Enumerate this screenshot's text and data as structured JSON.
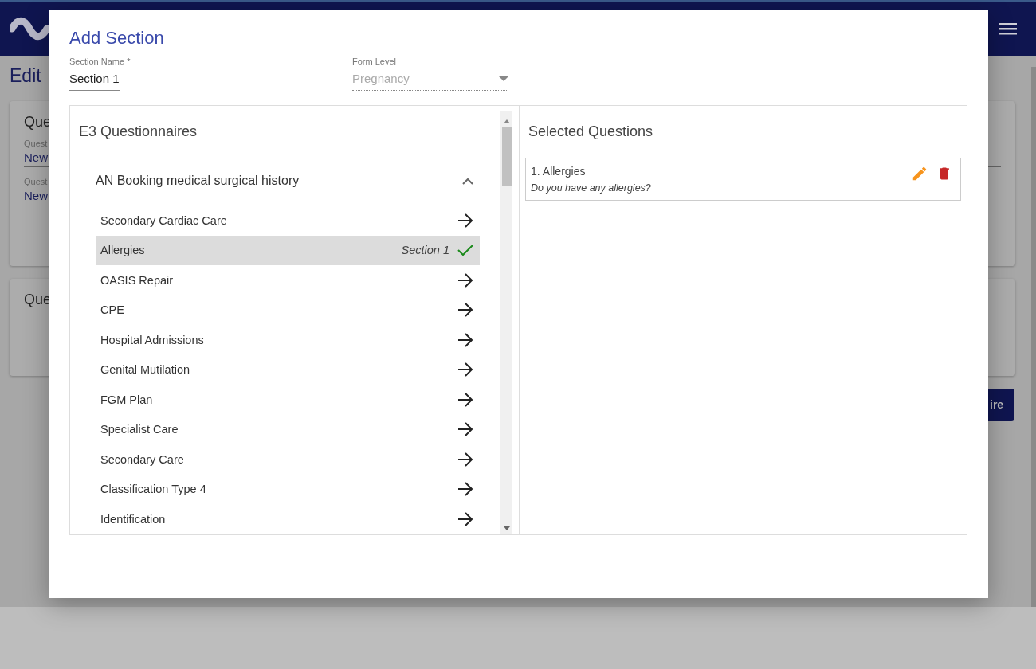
{
  "background": {
    "page_title": "Edit",
    "cards": [
      {
        "title": "Que",
        "fields": [
          {
            "label": "Quest",
            "value": "New"
          },
          {
            "label": "Quest",
            "value": "New"
          }
        ]
      },
      {
        "title": "Que"
      }
    ],
    "button": "ire"
  },
  "dialog": {
    "title": "Add Section",
    "section_name": {
      "label": "Section Name *",
      "value": "Section 1"
    },
    "form_level": {
      "label": "Form Level",
      "value": "Pregnancy",
      "disabled": true
    },
    "questionnaires": {
      "title": "E3 Questionnaires",
      "group": {
        "title": "AN Booking medical surgical history",
        "expanded": true,
        "items": [
          {
            "label": "Secondary Cardiac Care",
            "selected": false,
            "added": false
          },
          {
            "label": "Allergies",
            "selected": true,
            "added": true,
            "section": "Section 1"
          },
          {
            "label": "OASIS Repair",
            "selected": false,
            "added": false
          },
          {
            "label": "CPE",
            "selected": false,
            "added": false
          },
          {
            "label": "Hospital Admissions",
            "selected": false,
            "added": false
          },
          {
            "label": "Genital Mutilation",
            "selected": false,
            "added": false
          },
          {
            "label": "FGM Plan",
            "selected": false,
            "added": false
          },
          {
            "label": "Specialist Care",
            "selected": false,
            "added": false
          },
          {
            "label": "Secondary Care",
            "selected": false,
            "added": false
          },
          {
            "label": "Classification Type 4",
            "selected": false,
            "added": false
          },
          {
            "label": "Identification",
            "selected": false,
            "added": false
          }
        ]
      }
    },
    "selected_questions": {
      "title": "Selected Questions",
      "items": [
        {
          "title": "1. Allergies",
          "question": "Do you have any allergies?"
        }
      ]
    }
  }
}
